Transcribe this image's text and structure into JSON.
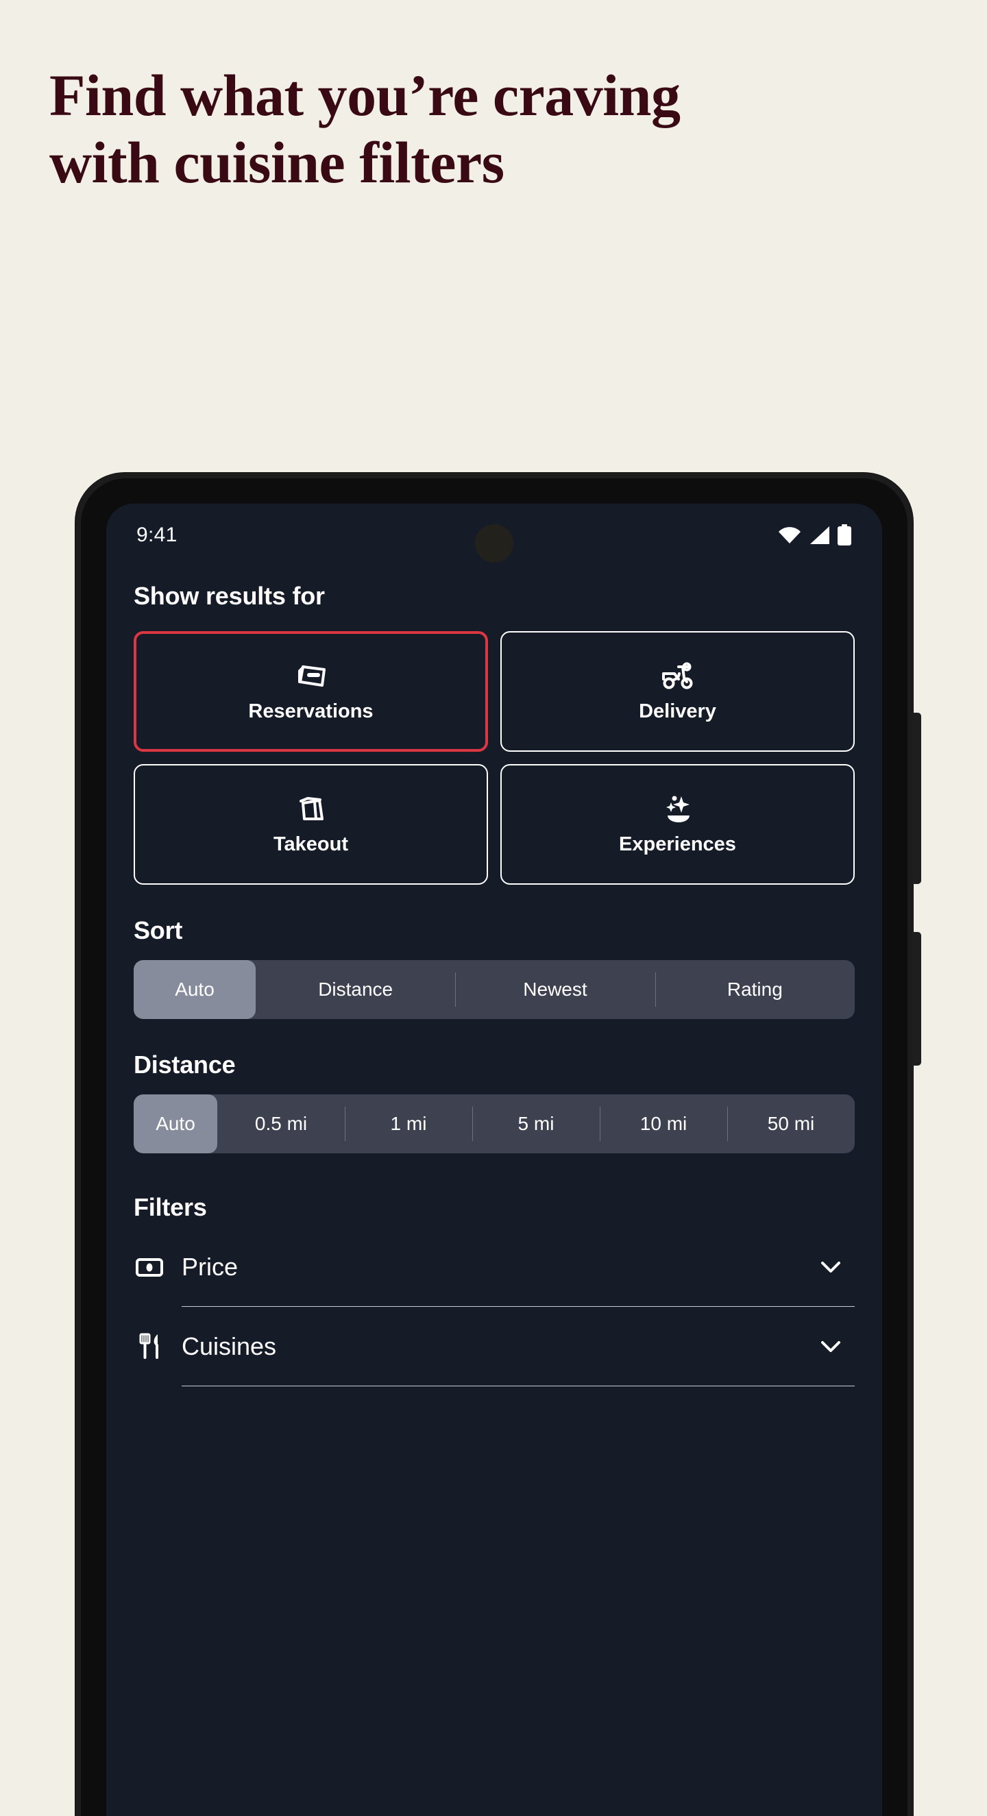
{
  "headline": {
    "line1": "Find what you’re craving",
    "line2": "with cuisine filters",
    "color": "#3A0A14"
  },
  "background_color": "#F2F0E6",
  "phone": {
    "screen_background": "#161B28",
    "frame_color": "#1C1C1C",
    "status_bar": {
      "time": "9:41",
      "icons": [
        "wifi-icon",
        "cellular-signal-icon",
        "battery-icon"
      ]
    }
  },
  "screen": {
    "show_results_for": {
      "title": "Show results for",
      "options": [
        {
          "label": "Reservations",
          "icon": "reservation-card-icon",
          "selected": true
        },
        {
          "label": "Delivery",
          "icon": "scooter-icon",
          "selected": false
        },
        {
          "label": "Takeout",
          "icon": "takeout-bag-icon",
          "selected": false
        },
        {
          "label": "Experiences",
          "icon": "sparkle-dish-icon",
          "selected": false
        }
      ],
      "selected_border_color": "#DA3743"
    },
    "sort": {
      "title": "Sort",
      "options": [
        "Auto",
        "Distance",
        "Newest",
        "Rating"
      ],
      "selected": "Auto"
    },
    "distance": {
      "title": "Distance",
      "options": [
        "Auto",
        "0.5 mi",
        "1 mi",
        "5 mi",
        "10 mi",
        "50 mi"
      ],
      "selected": "Auto"
    },
    "filters": {
      "title": "Filters",
      "rows": [
        {
          "label": "Price",
          "icon": "price-tag-icon",
          "chevron": "chevron-down-icon"
        },
        {
          "label": "Cuisines",
          "icon": "fork-knife-icon",
          "chevron": "chevron-down-icon"
        }
      ]
    }
  }
}
